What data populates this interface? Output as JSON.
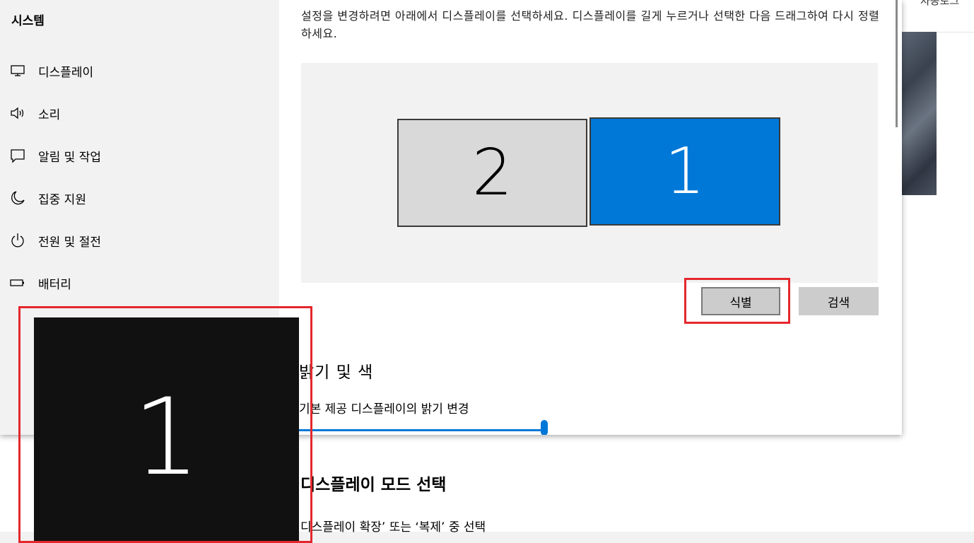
{
  "background_app": {
    "tab_text": "자동로그"
  },
  "sidebar": {
    "title": "시스템",
    "items": [
      {
        "label": "디스플레이",
        "icon": "monitor-icon"
      },
      {
        "label": "소리",
        "icon": "speaker-icon"
      },
      {
        "label": "알림 및 작업",
        "icon": "notification-icon"
      },
      {
        "label": "집중 지원",
        "icon": "moon-icon"
      },
      {
        "label": "전원 및 절전",
        "icon": "power-icon"
      },
      {
        "label": "배터리",
        "icon": "battery-icon"
      }
    ]
  },
  "content": {
    "instructions": "설정을 변경하려면 아래에서 디스플레이를 선택하세요. 디스플레이를 길게 누르거나 선택한 다음 드래그하여 다시 정렬하세요.",
    "monitors": [
      {
        "number": "2",
        "selected": false
      },
      {
        "number": "1",
        "selected": true
      }
    ],
    "identify_button": "식별",
    "detect_button": "검색",
    "brightness_title": "밝기 및 색",
    "brightness_label": "기본 제공 디스플레이의 밝기 변경",
    "brightness_value_percent": 100
  },
  "display_mode": {
    "title": "디스플레이 모드 선택",
    "description": "디스플레이 확장’ 또는 ‘복제’ 중 선택"
  },
  "identify_overlay": {
    "number": "1"
  },
  "colors": {
    "accent": "#0078d7",
    "highlight": "#e3282d"
  }
}
